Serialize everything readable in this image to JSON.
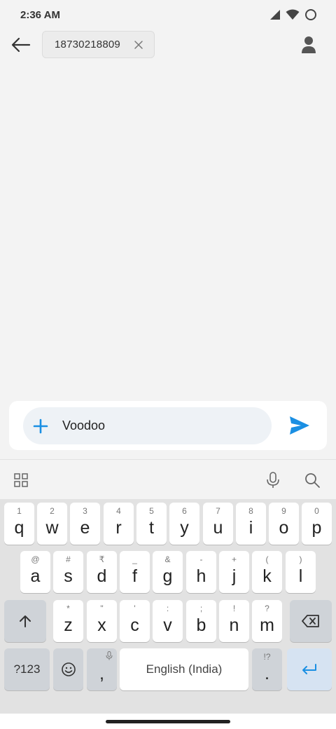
{
  "status_bar": {
    "time": "2:36 AM",
    "icons": [
      "signal-icon",
      "wifi-icon",
      "battery-icon"
    ]
  },
  "app_bar": {
    "recipient": "18730218809",
    "icons": [
      "back-arrow-icon",
      "close-icon",
      "contact-icon"
    ]
  },
  "compose": {
    "text": "Voodoo",
    "accent_color": "#1a8fe3"
  },
  "keyboard": {
    "row1": [
      {
        "hint": "1",
        "key": "q"
      },
      {
        "hint": "2",
        "key": "w"
      },
      {
        "hint": "3",
        "key": "e"
      },
      {
        "hint": "4",
        "key": "r"
      },
      {
        "hint": "5",
        "key": "t"
      },
      {
        "hint": "6",
        "key": "y"
      },
      {
        "hint": "7",
        "key": "u"
      },
      {
        "hint": "8",
        "key": "i"
      },
      {
        "hint": "9",
        "key": "o"
      },
      {
        "hint": "0",
        "key": "p"
      }
    ],
    "row2": [
      {
        "hint": "@",
        "key": "a"
      },
      {
        "hint": "#",
        "key": "s"
      },
      {
        "hint": "₹",
        "key": "d"
      },
      {
        "hint": "_",
        "key": "f"
      },
      {
        "hint": "&",
        "key": "g"
      },
      {
        "hint": "-",
        "key": "h"
      },
      {
        "hint": "+",
        "key": "j"
      },
      {
        "hint": "(",
        "key": "k"
      },
      {
        "hint": ")",
        "key": "l"
      }
    ],
    "row3": [
      {
        "hint": "*",
        "key": "z"
      },
      {
        "hint": "\"",
        "key": "x"
      },
      {
        "hint": "'",
        "key": "c"
      },
      {
        "hint": ":",
        "key": "v"
      },
      {
        "hint": ";",
        "key": "b"
      },
      {
        "hint": "!",
        "key": "n"
      },
      {
        "hint": "?",
        "key": "m"
      }
    ],
    "symbols_label": "?123",
    "comma": ",",
    "space_label": "English (India)",
    "period_hint": "!?",
    "period": "."
  }
}
